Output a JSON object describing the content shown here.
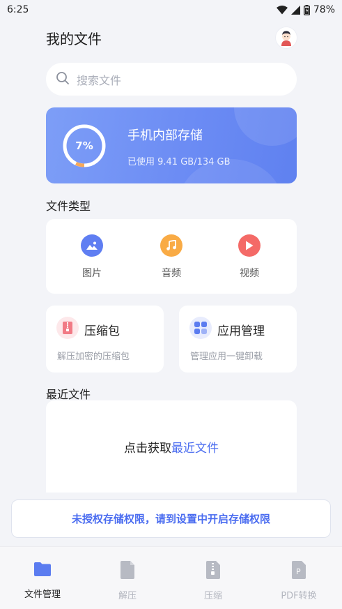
{
  "status_bar": {
    "time": "6:25",
    "battery": "78%"
  },
  "header": {
    "title": "我的文件"
  },
  "search": {
    "placeholder": "搜索文件"
  },
  "storage": {
    "percent_label": "7%",
    "used_fraction": 0.07,
    "title": "手机内部存储",
    "usage": "已使用 9.41 GB/134 GB"
  },
  "file_types": {
    "section_label": "文件类型",
    "items": [
      {
        "label": "图片",
        "icon": "image-icon",
        "color": "#5f7ef2"
      },
      {
        "label": "音频",
        "icon": "music-note-icon",
        "color": "#f9ab45"
      },
      {
        "label": "视频",
        "icon": "play-icon",
        "color": "#f46a67"
      }
    ]
  },
  "tools": [
    {
      "title": "压缩包",
      "desc": "解压加密的压缩包",
      "icon": "zip-file-icon",
      "color": "#f17a85"
    },
    {
      "title": "应用管理",
      "desc": "管理应用一键卸载",
      "icon": "app-grid-icon",
      "color": "#5b7cf0"
    }
  ],
  "recent": {
    "section_label": "最近文件",
    "prompt_prefix": "点击获取",
    "prompt_link": "最近文件"
  },
  "permission_banner": {
    "text": "未授权存储权限，请到设置中开启存储权限"
  },
  "tabbar": {
    "tabs": [
      {
        "label": "文件管理",
        "icon": "folder-icon",
        "active": true
      },
      {
        "label": "解压",
        "icon": "document-icon",
        "active": false
      },
      {
        "label": "压缩",
        "icon": "zip-icon",
        "active": false
      },
      {
        "label": "PDF转换",
        "icon": "pdf-icon",
        "active": false
      }
    ]
  },
  "colors": {
    "accent": "#5b7cf0",
    "background": "#f3f4f8"
  }
}
